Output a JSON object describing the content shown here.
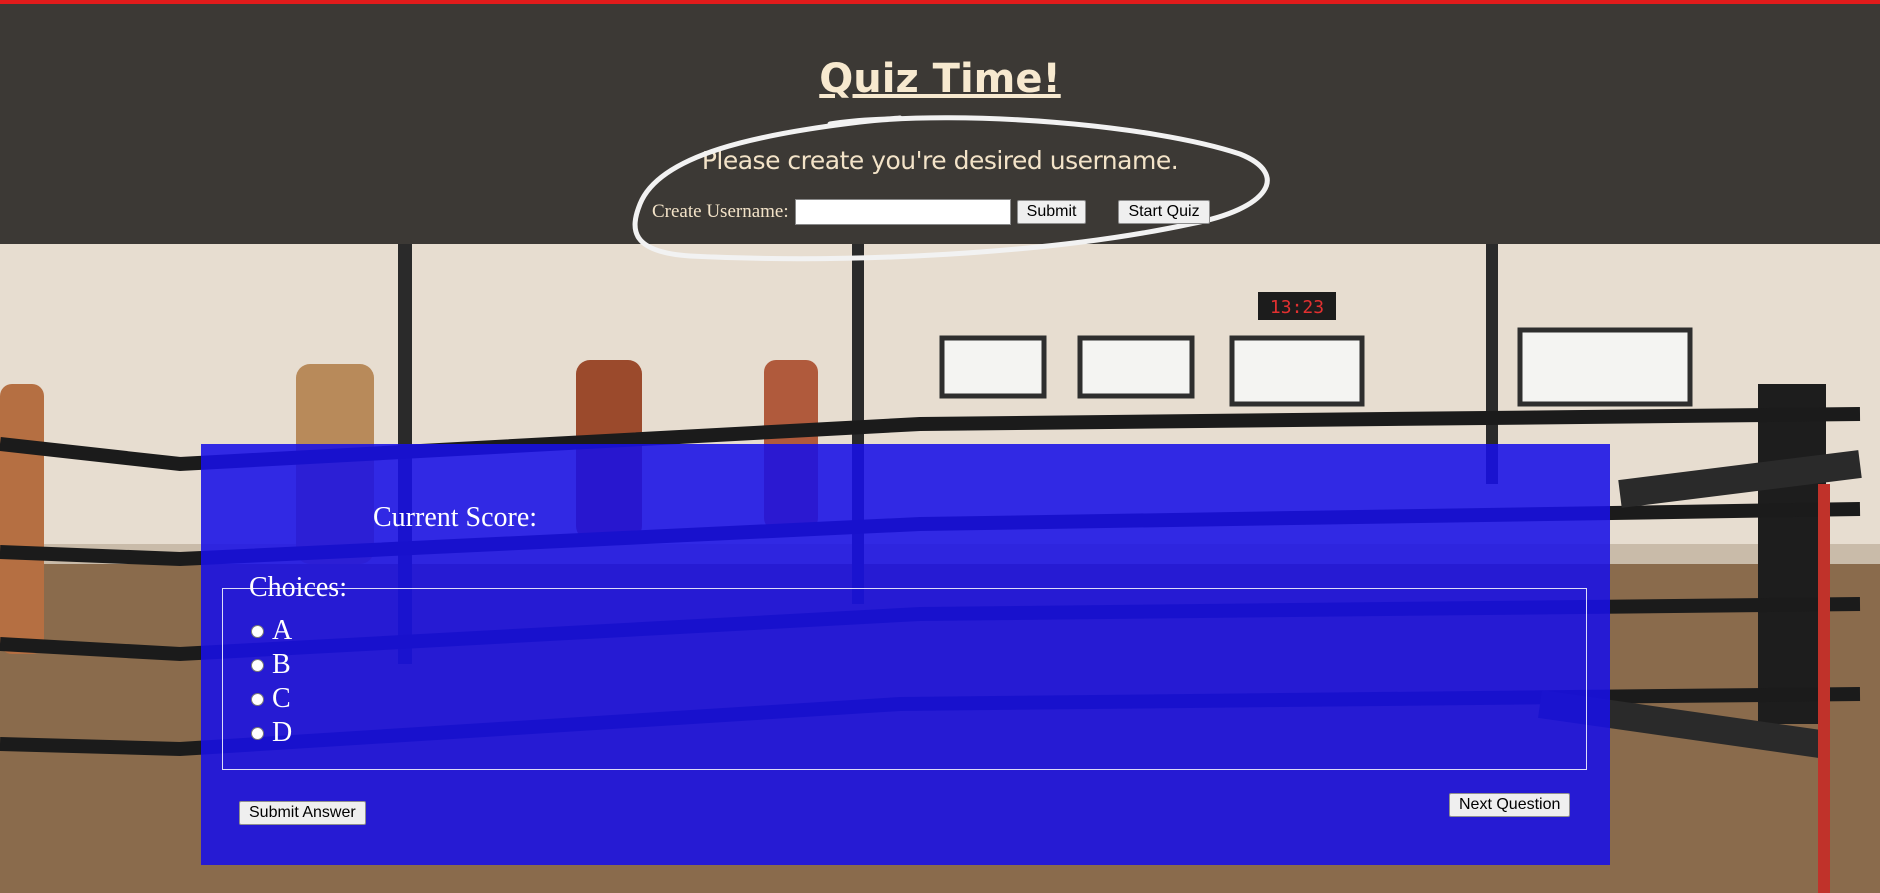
{
  "header": {
    "title": "Quiz Time!",
    "subtitle": "Please create you're desired username."
  },
  "username_form": {
    "label": "Create Username:",
    "input_value": "",
    "submit_label": "Submit",
    "start_label": "Start Quiz"
  },
  "quiz": {
    "score_label": "Current Score:",
    "choices_legend": "Choices:",
    "options": [
      "A",
      "B",
      "C",
      "D"
    ],
    "submit_answer_label": "Submit Answer",
    "next_question_label": "Next Question"
  },
  "background": {
    "clock_text": "13:23"
  },
  "colors": {
    "top_bar": "#e11b1b",
    "quiz_panel": "#1810e6",
    "header_text": "#f7e9cf"
  }
}
